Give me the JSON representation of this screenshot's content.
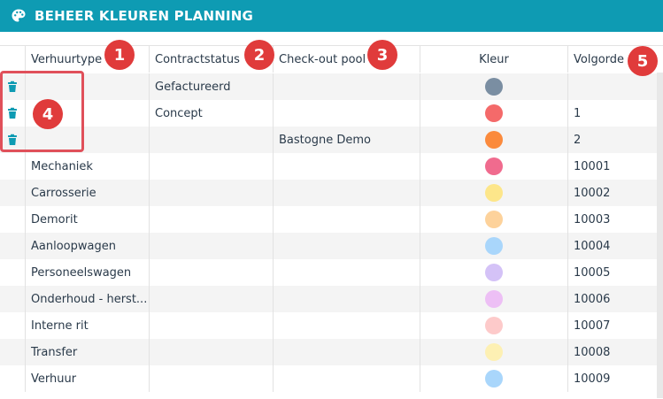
{
  "header": {
    "title": "BEHEER KLEUREN PLANNING",
    "icon": "palette-icon"
  },
  "columns": [
    "Verhuurtype",
    "Contractstatus",
    "Check-out pool",
    "Kleur",
    "Volgorde"
  ],
  "rows": [
    {
      "verhuurtype": "",
      "contractstatus": "Gefactureerd",
      "checkout": "",
      "kleur": "#7a8ea2",
      "volgorde": "",
      "deletable": true
    },
    {
      "verhuurtype": "",
      "contractstatus": "Concept",
      "checkout": "",
      "kleur": "#f46a6a",
      "volgorde": "1",
      "deletable": true
    },
    {
      "verhuurtype": "",
      "contractstatus": "",
      "checkout": "Bastogne Demo",
      "kleur": "#fb8a3c",
      "volgorde": "2",
      "deletable": true
    },
    {
      "verhuurtype": "Mechaniek",
      "contractstatus": "",
      "checkout": "",
      "kleur": "#f06b8e",
      "volgorde": "10001",
      "deletable": false
    },
    {
      "verhuurtype": "Carrosserie",
      "contractstatus": "",
      "checkout": "",
      "kleur": "#fde68a",
      "volgorde": "10002",
      "deletable": false
    },
    {
      "verhuurtype": "Demorit",
      "contractstatus": "",
      "checkout": "",
      "kleur": "#fdd29b",
      "volgorde": "10003",
      "deletable": false
    },
    {
      "verhuurtype": "Aanloopwagen",
      "contractstatus": "",
      "checkout": "",
      "kleur": "#a9d6fb",
      "volgorde": "10004",
      "deletable": false
    },
    {
      "verhuurtype": "Personeelswagen",
      "contractstatus": "",
      "checkout": "",
      "kleur": "#d4c2f7",
      "volgorde": "10005",
      "deletable": false
    },
    {
      "verhuurtype": "Onderhoud - herst...",
      "contractstatus": "",
      "checkout": "",
      "kleur": "#edbff5",
      "volgorde": "10006",
      "deletable": false
    },
    {
      "verhuurtype": "Interne rit",
      "contractstatus": "",
      "checkout": "",
      "kleur": "#fdcaca",
      "volgorde": "10007",
      "deletable": false
    },
    {
      "verhuurtype": "Transfer",
      "contractstatus": "",
      "checkout": "",
      "kleur": "#fdf0b3",
      "volgorde": "10008",
      "deletable": false
    },
    {
      "verhuurtype": "Verhuur",
      "contractstatus": "",
      "checkout": "",
      "kleur": "#a9d6fb",
      "volgorde": "10009",
      "deletable": false
    }
  ],
  "badges": [
    "1",
    "2",
    "3",
    "4",
    "5"
  ]
}
